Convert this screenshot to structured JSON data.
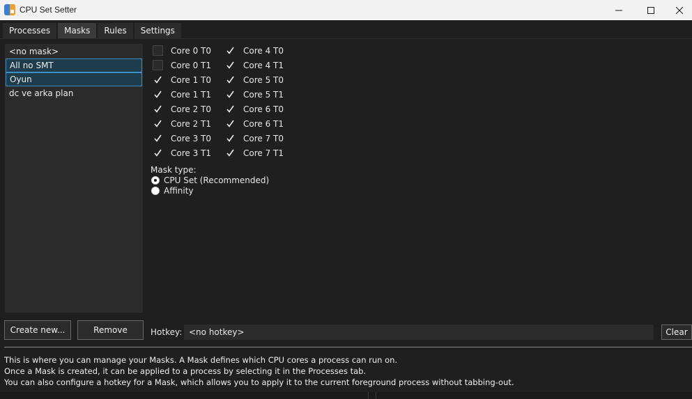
{
  "window": {
    "title": "CPU Set Setter"
  },
  "tabs": [
    {
      "label": "Processes",
      "active": false
    },
    {
      "label": "Masks",
      "active": true
    },
    {
      "label": "Rules",
      "active": false
    },
    {
      "label": "Settings",
      "active": false
    }
  ],
  "masks": {
    "items": [
      {
        "label": "<no mask>",
        "selected": false
      },
      {
        "label": "All no SMT",
        "selected": true
      },
      {
        "label": "Oyun",
        "selected": true
      },
      {
        "label": "dc ve arka plan",
        "selected": false
      }
    ]
  },
  "cores": {
    "left": [
      {
        "label": "Core 0 T0",
        "checked": false
      },
      {
        "label": "Core 0 T1",
        "checked": false
      },
      {
        "label": "Core 1 T0",
        "checked": true
      },
      {
        "label": "Core 1 T1",
        "checked": true
      },
      {
        "label": "Core 2 T0",
        "checked": true
      },
      {
        "label": "Core 2 T1",
        "checked": true
      },
      {
        "label": "Core 3 T0",
        "checked": true
      },
      {
        "label": "Core 3 T1",
        "checked": true
      }
    ],
    "right": [
      {
        "label": "Core 4 T0",
        "checked": true
      },
      {
        "label": "Core 4 T1",
        "checked": true
      },
      {
        "label": "Core 5 T0",
        "checked": true
      },
      {
        "label": "Core 5 T1",
        "checked": true
      },
      {
        "label": "Core 6 T0",
        "checked": true
      },
      {
        "label": "Core 6 T1",
        "checked": true
      },
      {
        "label": "Core 7 T0",
        "checked": true
      },
      {
        "label": "Core 7 T1",
        "checked": true
      }
    ]
  },
  "mask_type": {
    "label": "Mask type:",
    "options": [
      {
        "label": "CPU Set (Recommended)",
        "selected": true
      },
      {
        "label": "Affinity",
        "selected": false
      }
    ]
  },
  "buttons": {
    "create": "Create new...",
    "remove": "Remove",
    "clear": "Clear"
  },
  "hotkey": {
    "label": "Hotkey:",
    "value": "<no hotkey>"
  },
  "description": {
    "lines": [
      "This is where you can manage your Masks. A Mask defines which CPU cores a process can run on.",
      "Once a Mask is created, it can be applied to a process by selecting it in the Processes tab.",
      "You can also configure a hotkey for a Mask, which allows you to apply it to the current foreground process without tabbing-out."
    ]
  },
  "icons": {
    "app": "cpu-set-setter-icon",
    "minimize": "minimize-icon",
    "maximize": "maximize-icon",
    "close": "close-icon",
    "check": "checkmark-icon"
  }
}
